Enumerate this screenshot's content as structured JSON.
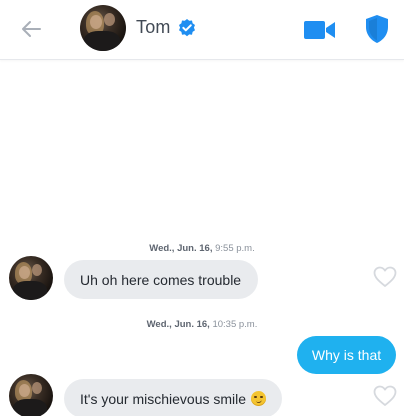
{
  "header": {
    "name": "Tom",
    "verified_color": "#1f8ef1",
    "accent_color": "#1f8ef1",
    "icons": [
      "back-arrow-icon",
      "verified-badge-icon",
      "video-call-icon",
      "safety-shield-icon"
    ]
  },
  "messages": [
    {
      "timestamp": {
        "date": "Wed., Jun. 16,",
        "time": "9:55 p.m."
      },
      "sender": "them",
      "text": "Uh oh here comes trouble"
    },
    {
      "timestamp": {
        "date": "Wed., Jun. 16,",
        "time": "10:35 p.m."
      },
      "sender": "me",
      "text": "Why is that"
    },
    {
      "sender": "them",
      "text": "It's your mischievous smile",
      "emoji": "smirking-face"
    }
  ],
  "colors": {
    "outgoing_bubble": "#1fb1ef",
    "incoming_bubble": "#e9ebee",
    "heart_outline": "#d6d9de"
  }
}
